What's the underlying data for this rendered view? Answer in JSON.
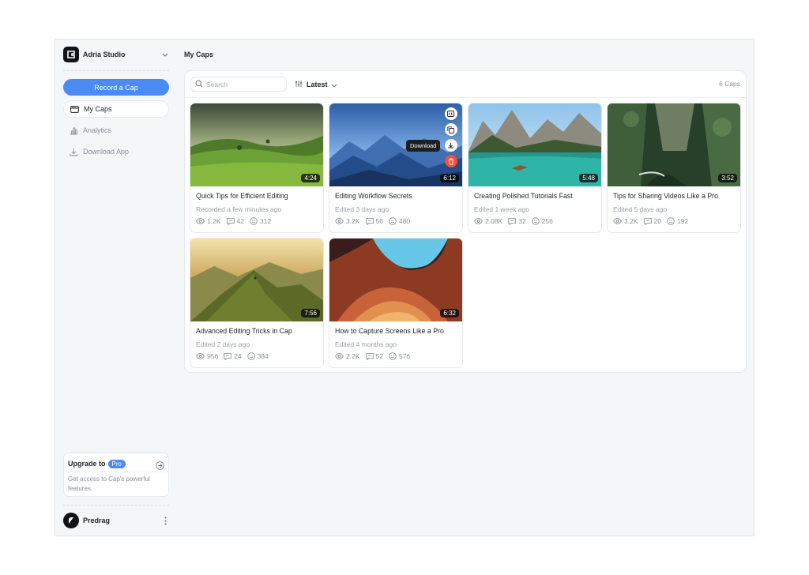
{
  "sidebar": {
    "workspace_name": "Adria Studio",
    "record_label": "Record a Cap",
    "nav": [
      {
        "label": "My Caps",
        "icon": "video-icon",
        "active": true
      },
      {
        "label": "Analytics",
        "icon": "bar-chart-icon",
        "active": false
      },
      {
        "label": "Download App",
        "icon": "download-icon",
        "active": false
      }
    ],
    "upgrade": {
      "title": "Upgrade to",
      "badge": "Pro",
      "description": "Get access to Cap's powerful features."
    },
    "user": {
      "name": "Predrag"
    }
  },
  "main": {
    "title": "My Caps",
    "search_placeholder": "Search",
    "sort_label": "Latest",
    "count": "6 Caps",
    "hover_tooltip": "Download",
    "cards": [
      {
        "title": "Quick Tips for Efficient Editing",
        "meta": "Recorded a few minutes ago",
        "duration": "4:24",
        "views": "1.2K",
        "comments": "42",
        "reactions": "312"
      },
      {
        "title": "Editing Workflow Secrets",
        "meta": "Edited 3 days ago",
        "duration": "6:12",
        "views": "3.2K",
        "comments": "56",
        "reactions": "480"
      },
      {
        "title": "Creating Polished Tutorials Fast",
        "meta": "Edited 1 week ago",
        "duration": "5:48",
        "views": "2.08K",
        "comments": "32",
        "reactions": "256"
      },
      {
        "title": "Tips for Sharing Videos Like a Pro",
        "meta": "Edited 5 days ago",
        "duration": "3:52",
        "views": "3.2K",
        "comments": "20",
        "reactions": "192"
      },
      {
        "title": "Advanced Editing Tricks in Cap",
        "meta": "Edited 2 days ago",
        "duration": "7:56",
        "views": "956",
        "comments": "24",
        "reactions": "384"
      },
      {
        "title": "How to Capture Screens Like a Pro",
        "meta": "Edited 4 months ago",
        "duration": "6:32",
        "views": "2.2K",
        "comments": "52",
        "reactions": "576"
      }
    ]
  },
  "colors": {
    "accent": "#4a8bf5",
    "danger": "#f0503c",
    "muted": "#8a8f98"
  }
}
